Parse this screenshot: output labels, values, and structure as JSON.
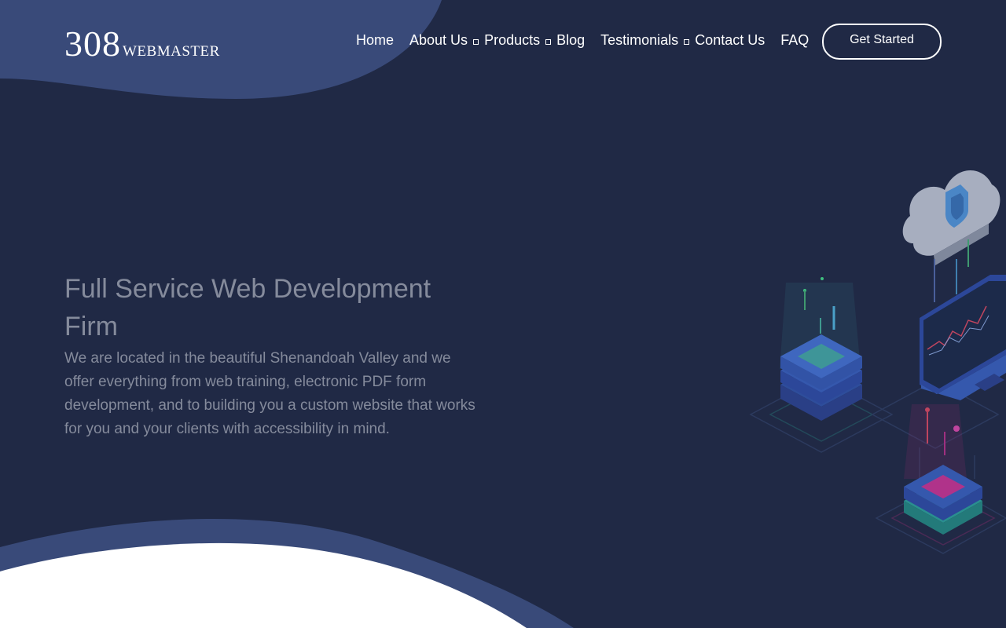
{
  "site": {
    "logo_number": "308",
    "logo_word": "WEBMASTER"
  },
  "nav": {
    "items": [
      {
        "label": "Home",
        "dropdown": false
      },
      {
        "label": "About Us",
        "dropdown": true
      },
      {
        "label": "Products",
        "dropdown": true
      },
      {
        "label": "Blog",
        "dropdown": false
      },
      {
        "label": "Testimonials",
        "dropdown": true
      },
      {
        "label": "Contact Us",
        "dropdown": false
      },
      {
        "label": "FAQ",
        "dropdown": false
      }
    ],
    "cta_label": "Get Started"
  },
  "hero": {
    "title": "Full Service Web Development Firm",
    "description": "We are located in the beautiful Shenandoah Valley and we offer everything from web training, electronic PDF form development, and to building you a custom website that works for you and your clients with accessibility in mind."
  },
  "colors": {
    "background": "#202945",
    "accent_wave": "#394a79",
    "text_muted": "#858b9c",
    "white": "#ffffff"
  },
  "illustration": {
    "icons": [
      "cloud-shield-icon",
      "server-stack-icon",
      "laptop-chart-icon",
      "server-stack-pink-icon"
    ]
  }
}
